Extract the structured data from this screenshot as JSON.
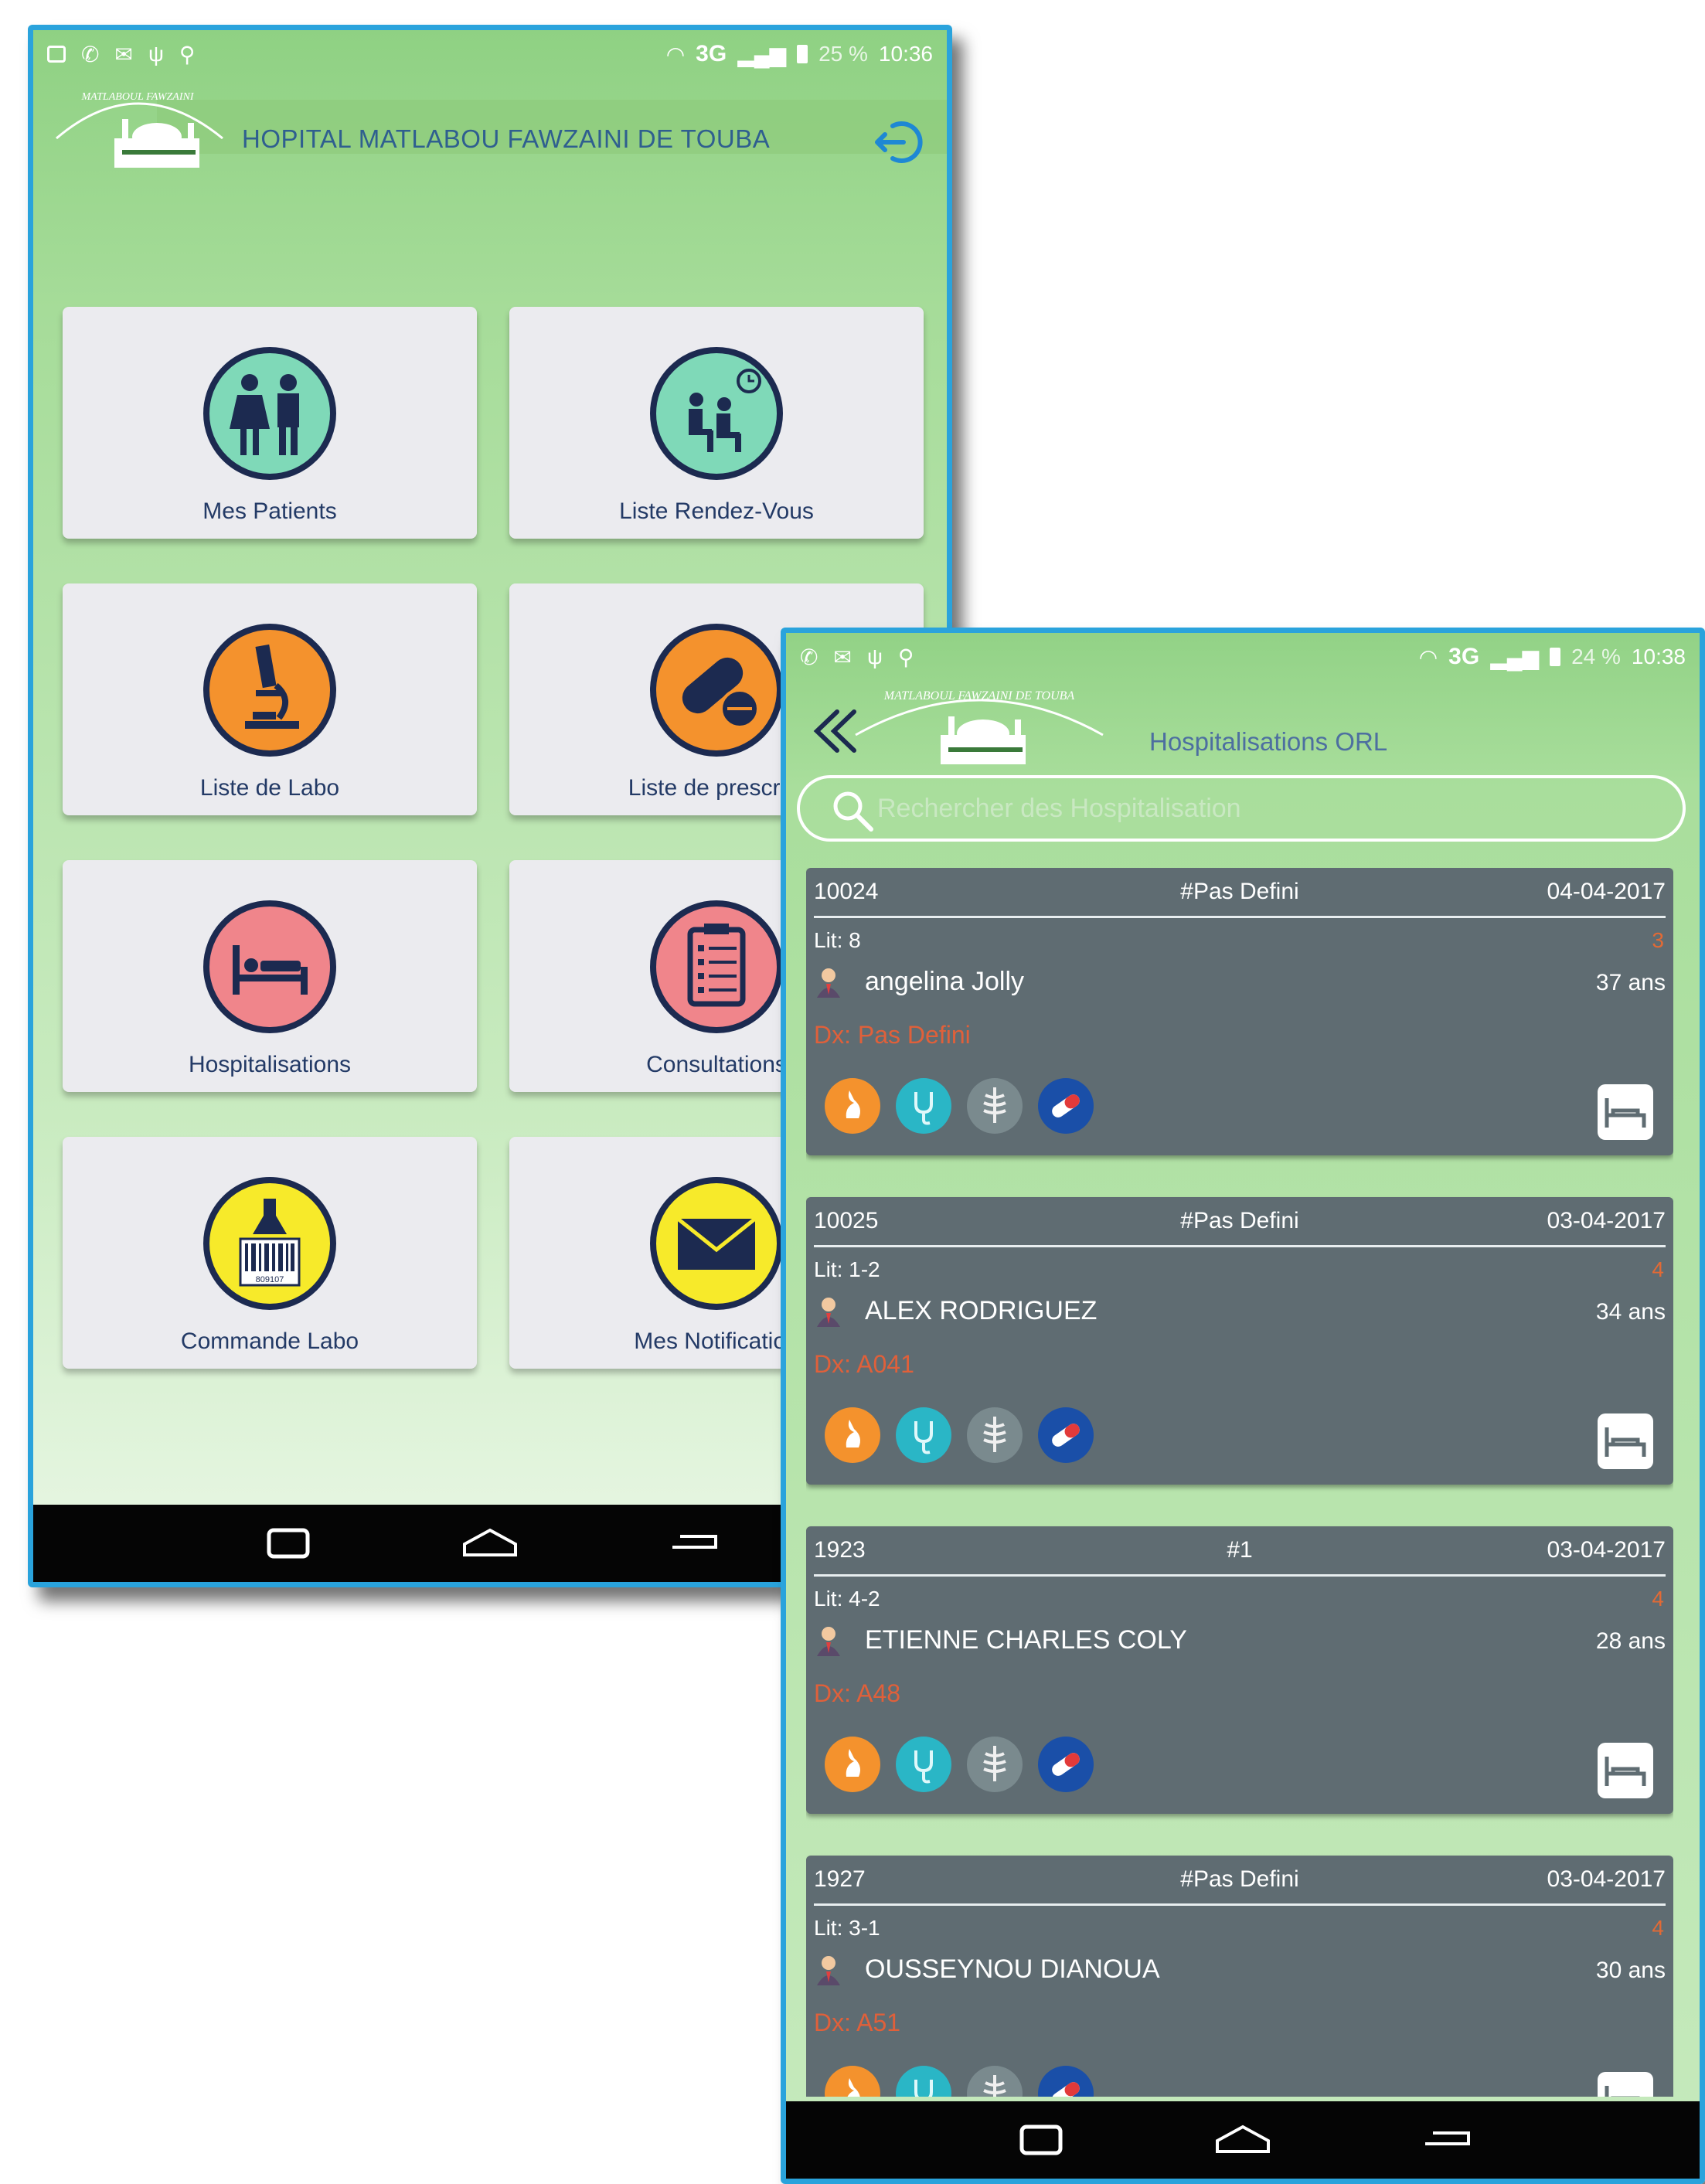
{
  "colors": {
    "frame": "#2aa3dc",
    "header_green": "#8fd183",
    "card_bg": "#5f6c72",
    "accent_red": "#e0603a",
    "tile_bg": "#ebebef",
    "label_blue": "#233a66"
  },
  "phone1": {
    "status": {
      "network": "3G",
      "battery": "25 %",
      "time": "10:36"
    },
    "header": {
      "title": "HOPITAL MATLABOU FAWZAINI DE TOUBA",
      "logo_text": "MATLABOUL FAWZAINI DE TOUBA",
      "logout_icon": "logout-icon"
    },
    "tiles": [
      {
        "label": "Mes Patients",
        "icon": "patients-icon"
      },
      {
        "label": "Liste Rendez-Vous",
        "icon": "appointments-icon"
      },
      {
        "label": "Liste de Labo",
        "icon": "microscope-icon"
      },
      {
        "label": "Liste de prescript",
        "icon": "pills-icon"
      },
      {
        "label": "Hospitalisations",
        "icon": "hospital-bed-icon"
      },
      {
        "label": "Consultations",
        "icon": "clipboard-icon"
      },
      {
        "label": "Commande Labo",
        "icon": "lab-barcode-icon",
        "barcode_text": "809107"
      },
      {
        "label": "Mes Notification",
        "icon": "envelope-icon"
      }
    ]
  },
  "phone2": {
    "status": {
      "network": "3G",
      "battery": "24 %",
      "time": "10:38"
    },
    "header": {
      "title": "Hospitalisations ORL",
      "logo_text": "MATLABOUL FAWZAINI DE TOUBA"
    },
    "search": {
      "placeholder": "Rechercher des Hospitalisation"
    },
    "cards": [
      {
        "id": "10024",
        "tag": "#Pas Defini",
        "date": "04-04-2017",
        "lit": "Lit: 8",
        "count": "3",
        "name": "angelina Jolly",
        "age": "37 ans",
        "dx": "Dx: Pas Defini"
      },
      {
        "id": "10025",
        "tag": "#Pas Defini",
        "date": "03-04-2017",
        "lit": "Lit: 1-2",
        "count": "4",
        "name": "ALEX RODRIGUEZ",
        "age": "34 ans",
        "dx": "Dx: A041"
      },
      {
        "id": "1923",
        "tag": "#1",
        "date": "03-04-2017",
        "lit": "Lit: 4-2",
        "count": "4",
        "name": "ETIENNE CHARLES COLY",
        "age": "28 ans",
        "dx": "Dx: A48"
      },
      {
        "id": "1927",
        "tag": "#Pas Defini",
        "date": "03-04-2017",
        "lit": "Lit: 3-1",
        "count": "4",
        "name": "OUSSEYNOU DIANOUA",
        "age": "30 ans",
        "dx": "Dx: A51"
      }
    ]
  }
}
